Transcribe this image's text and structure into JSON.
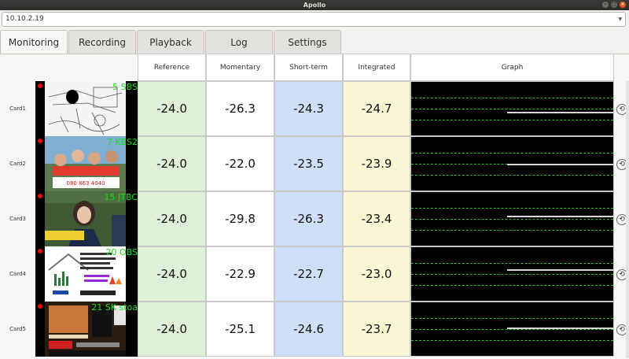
{
  "window": {
    "title": "Apollo"
  },
  "address": {
    "value": "10.10.2.19"
  },
  "tabs": [
    {
      "label": "Monitoring"
    },
    {
      "label": "Recording"
    },
    {
      "label": "Playback"
    },
    {
      "label": "Log"
    },
    {
      "label": "Settings"
    }
  ],
  "headers": {
    "reference": "Reference",
    "momentary": "Momentary",
    "short_term": "Short-term",
    "integrated": "Integrated",
    "graph": "Graph"
  },
  "colors": {
    "reference_bg": "#dff0d8",
    "short_term_bg": "#cfdff7",
    "integrated_bg": "#fcf6d4",
    "channel_text": "#18e018",
    "record_dot": "#e01010"
  },
  "rows": [
    {
      "card": "Card1",
      "channel": "5 SBS",
      "reference": "-24.0",
      "momentary": "-26.3",
      "short_term": "-24.3",
      "integrated": "-24.7"
    },
    {
      "card": "Card2",
      "channel": "7 KBS2",
      "reference": "-24.0",
      "momentary": "-22.0",
      "short_term": "-23.5",
      "integrated": "-23.9"
    },
    {
      "card": "Card3",
      "channel": "15 JTBC",
      "reference": "-24.0",
      "momentary": "-29.8",
      "short_term": "-26.3",
      "integrated": "-23.4"
    },
    {
      "card": "Card4",
      "channel": "20 OBS",
      "reference": "-24.0",
      "momentary": "-22.9",
      "short_term": "-22.7",
      "integrated": "-23.0"
    },
    {
      "card": "Card5",
      "channel": "21 SK stoa",
      "reference": "-24.0",
      "momentary": "-25.1",
      "short_term": "-24.6",
      "integrated": "-23.7"
    }
  ],
  "icons": {
    "reset": "reset-icon",
    "record": "record-dot-icon",
    "dropdown": "chevron-down-icon"
  }
}
